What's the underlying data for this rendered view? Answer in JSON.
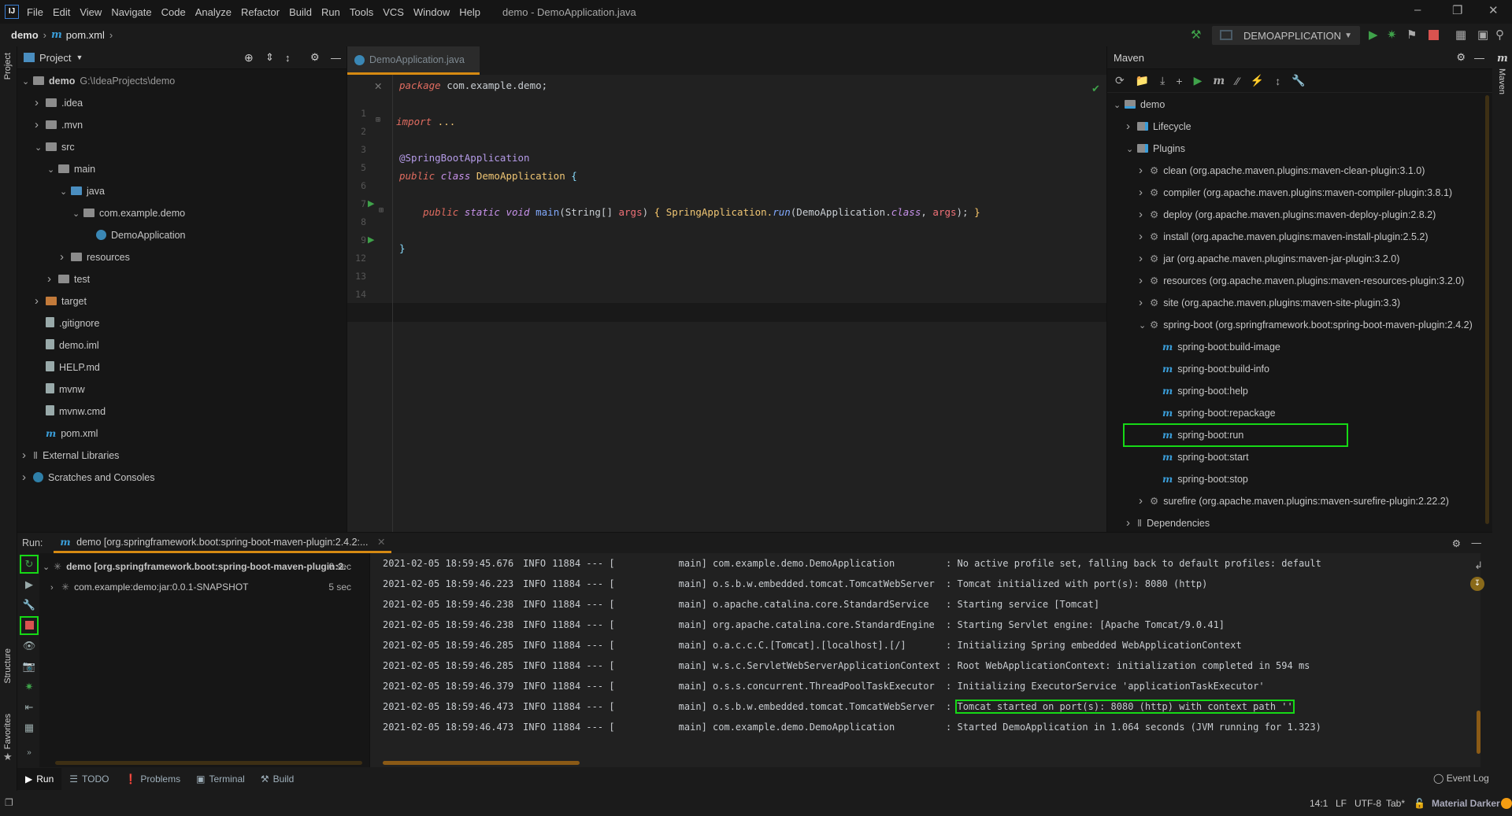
{
  "menu": {
    "items": [
      "File",
      "Edit",
      "View",
      "Navigate",
      "Code",
      "Analyze",
      "Refactor",
      "Build",
      "Run",
      "Tools",
      "VCS",
      "Window",
      "Help"
    ],
    "window_title": "demo - DemoApplication.java",
    "logo": "IJ"
  },
  "navbar": {
    "project": "demo",
    "file": "pom.xml",
    "run_config": "DEMOAPPLICATION"
  },
  "left_stripe": {
    "project": "Project",
    "structure": "Structure",
    "favorites": "Favorites"
  },
  "project_panel": {
    "title": "Project",
    "items": [
      {
        "label": "demo",
        "extra": "G:\\IdeaProjects\\demo",
        "depth": 0,
        "chev": "down",
        "icon": "folder",
        "bold": true
      },
      {
        "label": ".idea",
        "depth": 1,
        "chev": "right",
        "icon": "folder"
      },
      {
        "label": ".mvn",
        "depth": 1,
        "chev": "right",
        "icon": "folder"
      },
      {
        "label": "src",
        "depth": 1,
        "chev": "down",
        "icon": "folder"
      },
      {
        "label": "main",
        "depth": 2,
        "chev": "down",
        "icon": "folder"
      },
      {
        "label": "java",
        "depth": 3,
        "chev": "down",
        "icon": "folder-blue"
      },
      {
        "label": "com.example.demo",
        "depth": 4,
        "chev": "down",
        "icon": "folder"
      },
      {
        "label": "DemoApplication",
        "depth": 5,
        "chev": "",
        "icon": "class"
      },
      {
        "label": "resources",
        "depth": 3,
        "chev": "right",
        "icon": "folder"
      },
      {
        "label": "test",
        "depth": 2,
        "chev": "right",
        "icon": "folder"
      },
      {
        "label": "target",
        "depth": 1,
        "chev": "right",
        "icon": "folder-orange"
      },
      {
        "label": ".gitignore",
        "depth": 1,
        "chev": "",
        "icon": "file"
      },
      {
        "label": "demo.iml",
        "depth": 1,
        "chev": "",
        "icon": "file"
      },
      {
        "label": "HELP.md",
        "depth": 1,
        "chev": "",
        "icon": "file"
      },
      {
        "label": "mvnw",
        "depth": 1,
        "chev": "",
        "icon": "file"
      },
      {
        "label": "mvnw.cmd",
        "depth": 1,
        "chev": "",
        "icon": "file"
      },
      {
        "label": "pom.xml",
        "depth": 1,
        "chev": "",
        "icon": "maven"
      },
      {
        "label": "External Libraries",
        "depth": 0,
        "chev": "right",
        "icon": "library"
      },
      {
        "label": "Scratches and Consoles",
        "depth": 0,
        "chev": "right",
        "icon": "scratch"
      }
    ]
  },
  "editor": {
    "tab": "DemoApplication.java",
    "lines": [
      {
        "n": "1",
        "tokens": [
          [
            "package",
            "keyword"
          ],
          [
            " com.example.demo;",
            "plain"
          ]
        ]
      },
      {
        "n": "2",
        "tokens": []
      },
      {
        "n": "3",
        "tokens": [
          [
            "import",
            "keyword"
          ],
          [
            " ...",
            "import"
          ]
        ]
      },
      {
        "n": "5",
        "tokens": []
      },
      {
        "n": "6",
        "tokens": [
          [
            "@SpringBootApplication",
            "annotation"
          ]
        ]
      },
      {
        "n": "7",
        "run": true,
        "tokens": [
          [
            "public",
            "keyword"
          ],
          [
            " ",
            "plain"
          ],
          [
            "class",
            "modifier"
          ],
          [
            " DemoApplication ",
            "type"
          ],
          [
            "{",
            "punct"
          ]
        ]
      },
      {
        "n": "8",
        "tokens": []
      },
      {
        "n": "9",
        "run": true,
        "tokens": [
          [
            "    public",
            "keyword"
          ],
          [
            " ",
            "plain"
          ],
          [
            "static",
            "modifier"
          ],
          [
            " ",
            "plain"
          ],
          [
            "void",
            "modifier"
          ],
          [
            " ",
            "plain"
          ],
          [
            "main",
            "method"
          ],
          [
            "(String[] ",
            "plain"
          ],
          [
            "args",
            "param"
          ],
          [
            ") ",
            "plain"
          ],
          [
            "{ ",
            "brace"
          ],
          [
            "SpringApplication.",
            "type"
          ],
          [
            "run",
            "methodcall"
          ],
          [
            "(DemoApplication.",
            "plain"
          ],
          [
            "class",
            "modifier"
          ],
          [
            ", ",
            "plain"
          ],
          [
            "args",
            "param"
          ],
          [
            "); ",
            "plain"
          ],
          [
            "}",
            "brace"
          ]
        ]
      },
      {
        "n": "12",
        "tokens": []
      },
      {
        "n": "13",
        "tokens": [
          [
            "}",
            "punct"
          ]
        ]
      },
      {
        "n": "14",
        "tokens": []
      }
    ]
  },
  "maven": {
    "title": "Maven",
    "stripe_label": "Maven",
    "items": [
      {
        "label": "demo",
        "depth": 0,
        "chev": "down",
        "icon": "project"
      },
      {
        "label": "Lifecycle",
        "depth": 1,
        "chev": "right",
        "icon": "folder-gear"
      },
      {
        "label": "Plugins",
        "depth": 1,
        "chev": "down",
        "icon": "folder-gear"
      },
      {
        "label": "clean (org.apache.maven.plugins:maven-clean-plugin:3.1.0)",
        "depth": 2,
        "chev": "right",
        "icon": "plugin"
      },
      {
        "label": "compiler (org.apache.maven.plugins:maven-compiler-plugin:3.8.1)",
        "depth": 2,
        "chev": "right",
        "icon": "plugin"
      },
      {
        "label": "deploy (org.apache.maven.plugins:maven-deploy-plugin:2.8.2)",
        "depth": 2,
        "chev": "right",
        "icon": "plugin"
      },
      {
        "label": "install (org.apache.maven.plugins:maven-install-plugin:2.5.2)",
        "depth": 2,
        "chev": "right",
        "icon": "plugin"
      },
      {
        "label": "jar (org.apache.maven.plugins:maven-jar-plugin:3.2.0)",
        "depth": 2,
        "chev": "right",
        "icon": "plugin"
      },
      {
        "label": "resources (org.apache.maven.plugins:maven-resources-plugin:3.2.0)",
        "depth": 2,
        "chev": "right",
        "icon": "plugin"
      },
      {
        "label": "site (org.apache.maven.plugins:maven-site-plugin:3.3)",
        "depth": 2,
        "chev": "right",
        "icon": "plugin"
      },
      {
        "label": "spring-boot (org.springframework.boot:spring-boot-maven-plugin:2.4.2)",
        "depth": 2,
        "chev": "down",
        "icon": "plugin"
      },
      {
        "label": "spring-boot:build-image",
        "depth": 3,
        "chev": "",
        "icon": "goal"
      },
      {
        "label": "spring-boot:build-info",
        "depth": 3,
        "chev": "",
        "icon": "goal"
      },
      {
        "label": "spring-boot:help",
        "depth": 3,
        "chev": "",
        "icon": "goal"
      },
      {
        "label": "spring-boot:repackage",
        "depth": 3,
        "chev": "",
        "icon": "goal"
      },
      {
        "label": "spring-boot:run",
        "depth": 3,
        "chev": "",
        "icon": "goal",
        "selected": true
      },
      {
        "label": "spring-boot:start",
        "depth": 3,
        "chev": "",
        "icon": "goal"
      },
      {
        "label": "spring-boot:stop",
        "depth": 3,
        "chev": "",
        "icon": "goal"
      },
      {
        "label": "surefire (org.apache.maven.plugins:maven-surefire-plugin:2.22.2)",
        "depth": 2,
        "chev": "right",
        "icon": "plugin"
      },
      {
        "label": "Dependencies",
        "depth": 1,
        "chev": "right",
        "icon": "library"
      }
    ]
  },
  "run": {
    "label": "Run:",
    "tab": "demo [org.springframework.boot:spring-boot-maven-plugin:2.4.2:...",
    "tree": [
      {
        "label": "demo [org.springframework.boot:spring-boot-maven-plugin:2.",
        "time": "6 sec",
        "bold": true
      },
      {
        "label": "com.example:demo:jar:0.0.1-SNAPSHOT",
        "time": "5 sec"
      }
    ],
    "log": [
      {
        "ts": "2021-02-05 18:59:45.676",
        "level": "INFO",
        "pid": "11884",
        "thread": "main",
        "logger": "com.example.demo.DemoApplication",
        "msg": "No active profile set, falling back to default profiles: default"
      },
      {
        "ts": "2021-02-05 18:59:46.223",
        "level": "INFO",
        "pid": "11884",
        "thread": "main",
        "logger": "o.s.b.w.embedded.tomcat.TomcatWebServer",
        "msg": "Tomcat initialized with port(s): 8080 (http)"
      },
      {
        "ts": "2021-02-05 18:59:46.238",
        "level": "INFO",
        "pid": "11884",
        "thread": "main",
        "logger": "o.apache.catalina.core.StandardService",
        "msg": "Starting service [Tomcat]"
      },
      {
        "ts": "2021-02-05 18:59:46.238",
        "level": "INFO",
        "pid": "11884",
        "thread": "main",
        "logger": "org.apache.catalina.core.StandardEngine",
        "msg": "Starting Servlet engine: [Apache Tomcat/9.0.41]"
      },
      {
        "ts": "2021-02-05 18:59:46.285",
        "level": "INFO",
        "pid": "11884",
        "thread": "main",
        "logger": "o.a.c.c.C.[Tomcat].[localhost].[/]",
        "msg": "Initializing Spring embedded WebApplicationContext"
      },
      {
        "ts": "2021-02-05 18:59:46.285",
        "level": "INFO",
        "pid": "11884",
        "thread": "main",
        "logger": "w.s.c.ServletWebServerApplicationContext",
        "msg": "Root WebApplicationContext: initialization completed in 594 ms"
      },
      {
        "ts": "2021-02-05 18:59:46.379",
        "level": "INFO",
        "pid": "11884",
        "thread": "main",
        "logger": "o.s.s.concurrent.ThreadPoolTaskExecutor",
        "msg": "Initializing ExecutorService 'applicationTaskExecutor'"
      },
      {
        "ts": "2021-02-05 18:59:46.473",
        "level": "INFO",
        "pid": "11884",
        "thread": "main",
        "logger": "o.s.b.w.embedded.tomcat.TomcatWebServer",
        "msg": "Tomcat started on port(s): 8080 (http) with context path ''",
        "highlight": true
      },
      {
        "ts": "2021-02-05 18:59:46.473",
        "level": "INFO",
        "pid": "11884",
        "thread": "main",
        "logger": "com.example.demo.DemoApplication",
        "msg": "Started DemoApplication in 1.064 seconds (JVM running for 1.323)"
      }
    ]
  },
  "bottom_tabs": [
    {
      "label": "Run",
      "icon": "run-icon"
    },
    {
      "label": "TODO",
      "icon": "list-icon"
    },
    {
      "label": "Problems",
      "icon": "warning-icon"
    },
    {
      "label": "Terminal",
      "icon": "terminal-icon"
    },
    {
      "label": "Build",
      "icon": "hammer-icon"
    }
  ],
  "status": {
    "event_log": "Event Log",
    "position": "14:1",
    "line_sep": "LF",
    "encoding": "UTF-8",
    "indent": "Tab*",
    "theme": "Material Darker"
  },
  "colors": {
    "accent": "#d68a12",
    "highlight": "#16d916",
    "run_green": "#3fa24a",
    "stop_red": "#d9534f",
    "maven_blue": "#3a9dd8"
  }
}
